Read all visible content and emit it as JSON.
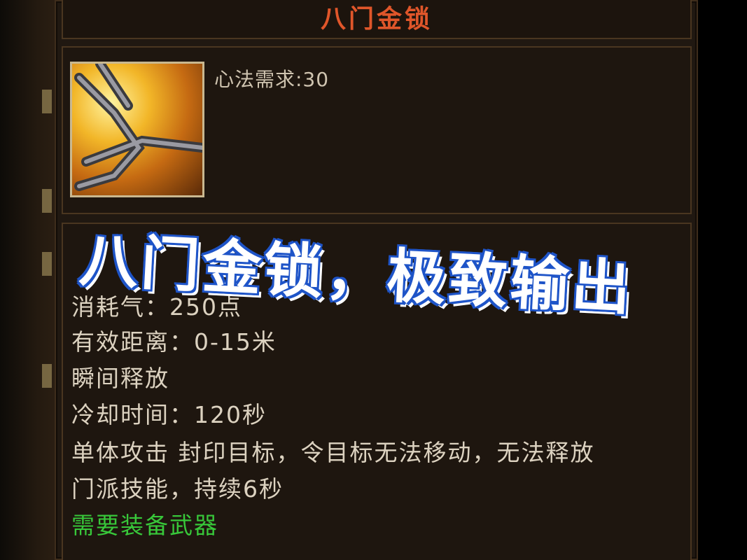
{
  "tooltip": {
    "title": "八门金锁",
    "requirement": "心法需求:30",
    "lines": [
      "消耗气：250点",
      "有效距离：0-15米",
      "瞬间释放",
      "冷却时间：120秒",
      "单体攻击 封印目标，令目标无法移动，无法释放",
      "门派技能，持续6秒"
    ],
    "equip_note": "需要装备武器"
  },
  "overlay": {
    "caption": "八门金锁，极致输出"
  },
  "colors": {
    "title": "#e0562a",
    "text": "#dcd2c0",
    "equip_note": "#38c83a",
    "caption_fill": "#ffffff",
    "caption_stroke": "#1e54c8"
  },
  "icon": {
    "name": "golden-chain-lock-icon"
  }
}
